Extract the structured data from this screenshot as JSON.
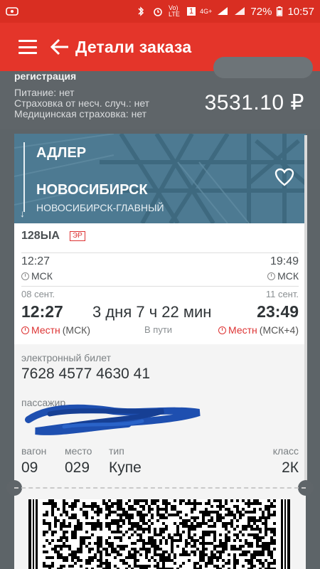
{
  "status_bar": {
    "battery": "72%",
    "time": "10:57",
    "network": "4G+",
    "volte": "Vo) LTE",
    "sim": "1"
  },
  "app_bar": {
    "title": "Детали заказа"
  },
  "summary": {
    "registration": "регистрация",
    "food": "Питание: нет",
    "insurance_accident": "Страховка от несч. случ.: нет",
    "insurance_medical": "Медицинская страховка: нет",
    "price": "3531.10 ₽"
  },
  "ticket": {
    "from_city": "АДЛЕР",
    "to_city": "НОВОСИБИРСК",
    "to_station": "НОВОСИБИРСК-ГЛАВНЫЙ",
    "train_number": "128ЫА",
    "er_badge": "ЭР",
    "dep_time_msk": "12:27",
    "arr_time_msk": "19:49",
    "msk_label_left": "МСК",
    "msk_label_right": "МСК",
    "dep_date": "08 сент.",
    "arr_date": "11 сент.",
    "dep_time_local": "12:27",
    "arr_time_local": "23:49",
    "duration": "3 дня 7 ч 22 мин",
    "in_transit": "В пути",
    "local_label": "Местн",
    "dep_tz": "(МСК)",
    "arr_tz": "(МСК+4)",
    "eticket_label": "электронный билет",
    "eticket_number": "7628 4577 4630 41",
    "passenger_label": "пассажир",
    "car_label": "вагон",
    "seat_label": "место",
    "type_label": "тип",
    "class_label": "класс",
    "car_value": "09",
    "seat_value": "029",
    "type_value": "Купе",
    "class_value": "2К"
  },
  "colors": {
    "brand_red": "#e4352a",
    "status_red": "#d92e22",
    "background_gray": "#5f6569",
    "hero_blue": "#4f7f98"
  },
  "icons": [
    "hamburger-menu-icon",
    "back-arrow-icon",
    "heart-icon",
    "clock-icon",
    "bluetooth-icon",
    "alarm-icon",
    "wifi-icon",
    "battery-icon"
  ]
}
